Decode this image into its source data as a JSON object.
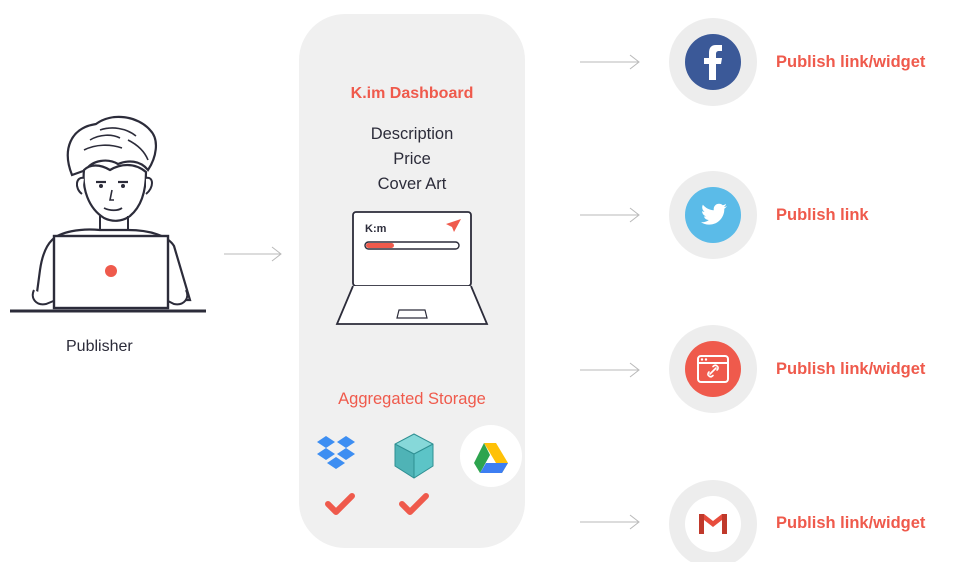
{
  "publisher": {
    "label": "Publisher"
  },
  "dashboard": {
    "title": "K.im Dashboard",
    "lines": [
      "Description",
      "Price",
      "Cover Art"
    ],
    "laptop_logo": "K:m",
    "storage_title": "Aggregated Storage",
    "storage": [
      {
        "icon": "dropbox-icon",
        "checked": true
      },
      {
        "icon": "storage-cube-icon",
        "checked": true
      },
      {
        "icon": "google-drive-icon",
        "checked": false
      }
    ]
  },
  "channels": [
    {
      "icon": "facebook-icon",
      "label": "Publish link/widget",
      "color": "#3b5998"
    },
    {
      "icon": "twitter-icon",
      "label": "Publish link",
      "color": "#5bbbe8"
    },
    {
      "icon": "website-icon",
      "label": "Publish link/widget",
      "color": "#ef5a4c"
    },
    {
      "icon": "gmail-icon",
      "label": "Publish link/widget",
      "color": "#ffffff"
    }
  ],
  "colors": {
    "accent": "#ef5a4c",
    "panel": "#f0f0f0",
    "text": "#2c2c3a"
  }
}
